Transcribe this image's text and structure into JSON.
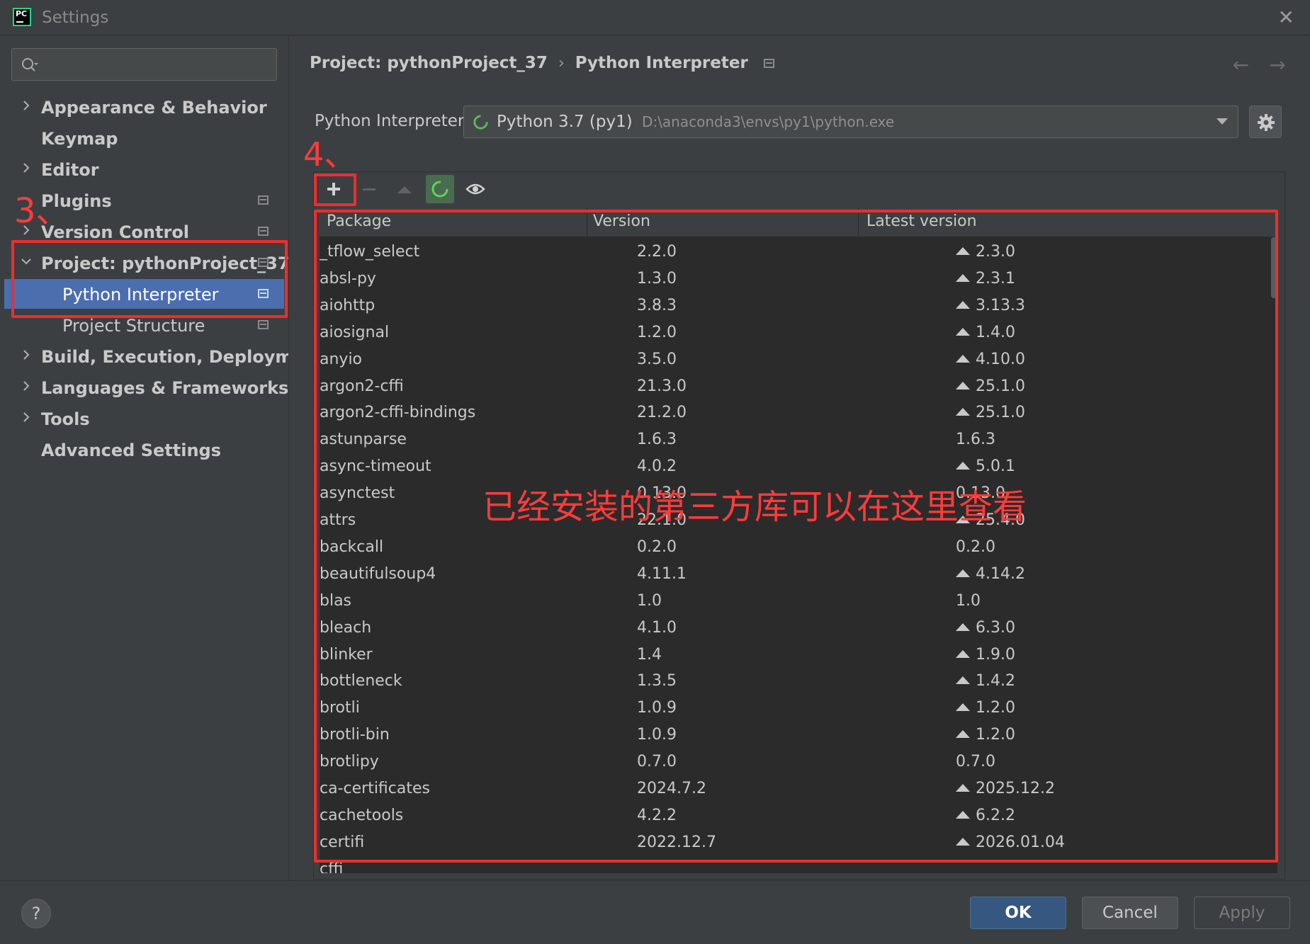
{
  "window": {
    "title": "Settings",
    "app_logo_text": "PC",
    "close": "✕"
  },
  "search": {
    "placeholder": "",
    "value": ""
  },
  "sidebar": {
    "items": [
      {
        "label": "Appearance & Behavior",
        "expandable": true,
        "expanded": false,
        "pin": false,
        "level": 0
      },
      {
        "label": "Keymap",
        "expandable": false,
        "pin": false,
        "level": 0
      },
      {
        "label": "Editor",
        "expandable": true,
        "expanded": false,
        "pin": false,
        "level": 0
      },
      {
        "label": "Plugins",
        "expandable": false,
        "pin": true,
        "level": 0
      },
      {
        "label": "Version Control",
        "expandable": true,
        "expanded": false,
        "pin": true,
        "level": 0
      },
      {
        "label": "Project: pythonProject_37",
        "expandable": true,
        "expanded": true,
        "pin": true,
        "level": 0
      },
      {
        "label": "Python Interpreter",
        "expandable": false,
        "pin": true,
        "level": 1,
        "selected": true
      },
      {
        "label": "Project Structure",
        "expandable": false,
        "pin": true,
        "level": 1
      },
      {
        "label": "Build, Execution, Deployment",
        "expandable": true,
        "expanded": false,
        "pin": false,
        "level": 0
      },
      {
        "label": "Languages & Frameworks",
        "expandable": true,
        "expanded": false,
        "pin": false,
        "level": 0
      },
      {
        "label": "Tools",
        "expandable": true,
        "expanded": false,
        "pin": false,
        "level": 0
      },
      {
        "label": "Advanced Settings",
        "expandable": false,
        "pin": false,
        "level": 0
      }
    ]
  },
  "breadcrumb": {
    "project": "Project: pythonProject_37",
    "separator": "›",
    "page": "Python Interpreter"
  },
  "nav": {
    "back": "←",
    "forward": "→"
  },
  "interpreter": {
    "label": "Python Interpreter:",
    "name": "Python 3.7 (py1)",
    "path": "D:\\anaconda3\\envs\\py1\\python.exe"
  },
  "toolbar": {
    "add": "+",
    "remove": "−",
    "upgrade": "▲",
    "refresh": "refresh-icon",
    "show": "eye-icon"
  },
  "table": {
    "columns": [
      "Package",
      "Version",
      "Latest version"
    ],
    "rows": [
      [
        "_tflow_select",
        "2.2.0",
        "2.3.0",
        true
      ],
      [
        "absl-py",
        "1.3.0",
        "2.3.1",
        true
      ],
      [
        "aiohttp",
        "3.8.3",
        "3.13.3",
        true
      ],
      [
        "aiosignal",
        "1.2.0",
        "1.4.0",
        true
      ],
      [
        "anyio",
        "3.5.0",
        "4.10.0",
        true
      ],
      [
        "argon2-cffi",
        "21.3.0",
        "25.1.0",
        true
      ],
      [
        "argon2-cffi-bindings",
        "21.2.0",
        "25.1.0",
        true
      ],
      [
        "astunparse",
        "1.6.3",
        "1.6.3",
        false
      ],
      [
        "async-timeout",
        "4.0.2",
        "5.0.1",
        true
      ],
      [
        "asynctest",
        "0.13.0",
        "0.13.0",
        false
      ],
      [
        "attrs",
        "22.1.0",
        "25.4.0",
        true
      ],
      [
        "backcall",
        "0.2.0",
        "0.2.0",
        false
      ],
      [
        "beautifulsoup4",
        "4.11.1",
        "4.14.2",
        true
      ],
      [
        "blas",
        "1.0",
        "1.0",
        false
      ],
      [
        "bleach",
        "4.1.0",
        "6.3.0",
        true
      ],
      [
        "blinker",
        "1.4",
        "1.9.0",
        true
      ],
      [
        "bottleneck",
        "1.3.5",
        "1.4.2",
        true
      ],
      [
        "brotli",
        "1.0.9",
        "1.2.0",
        true
      ],
      [
        "brotli-bin",
        "1.0.9",
        "1.2.0",
        true
      ],
      [
        "brotlipy",
        "0.7.0",
        "0.7.0",
        false
      ],
      [
        "ca-certificates",
        "2024.7.2",
        "2025.12.2",
        true
      ],
      [
        "cachetools",
        "4.2.2",
        "6.2.2",
        true
      ],
      [
        "certifi",
        "2022.12.7",
        "2026.01.04",
        true
      ],
      [
        "cffi",
        "",
        "",
        false
      ]
    ]
  },
  "annotations": {
    "step3": "3、",
    "step4": "4、",
    "note": "已经安装的第三方库可以在这里查看",
    "color": "#ee2e2e"
  },
  "footer": {
    "help": "?",
    "ok": "OK",
    "cancel": "Cancel",
    "apply": "Apply"
  },
  "colors": {
    "selection": "#4b6eaf",
    "ok_button": "#365880",
    "background": "#3c3f41",
    "table_bg": "#2b2b2b",
    "refresh_green": "#4a6b4f"
  }
}
